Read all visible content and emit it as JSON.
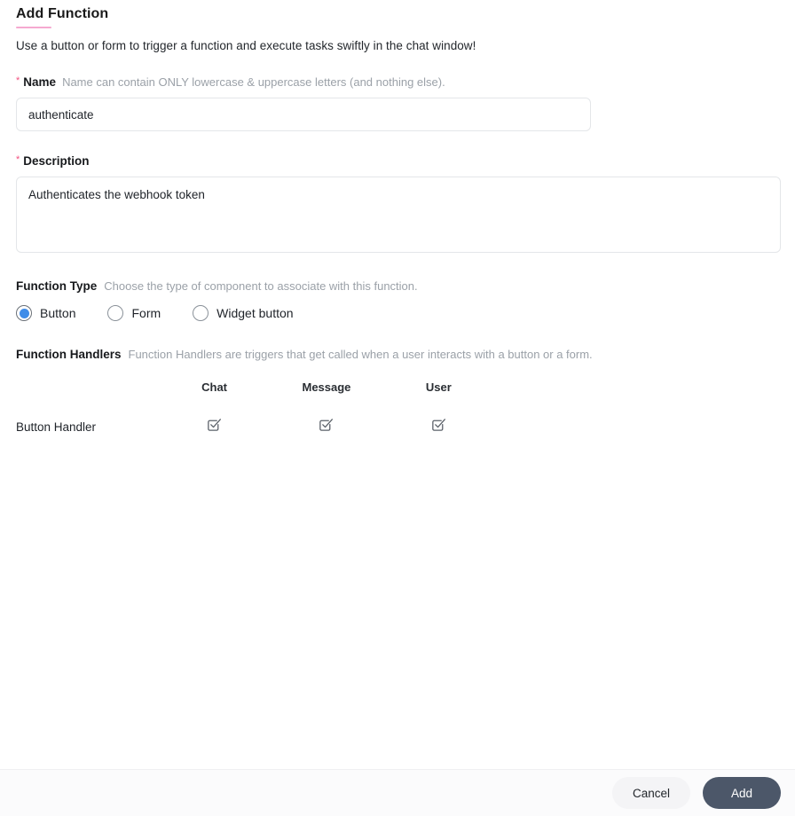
{
  "header": {
    "title": "Add Function",
    "subtitle": "Use a button or form to trigger a function and execute tasks swiftly in the chat window!",
    "accent_color": "#f5a9d0"
  },
  "name_field": {
    "required_marker": "*",
    "label": "Name",
    "hint": "Name can contain ONLY lowercase & uppercase letters (and nothing else).",
    "value": "authenticate",
    "placeholder": ""
  },
  "description_field": {
    "required_marker": "*",
    "label": "Description",
    "value": "Authenticates the webhook token",
    "placeholder": ""
  },
  "function_type": {
    "label": "Function Type",
    "hint": "Choose the type of component to associate with this function.",
    "selected": "Button",
    "selected_color": "#3f8ce8",
    "options": [
      {
        "label": "Button",
        "checked": true
      },
      {
        "label": "Form",
        "checked": false
      },
      {
        "label": "Widget button",
        "checked": false
      }
    ]
  },
  "function_handlers": {
    "label": "Function Handlers",
    "hint": "Function Handlers are triggers that get called when a user interacts with a button or a form.",
    "columns": [
      "Chat",
      "Message",
      "User"
    ],
    "rows": [
      {
        "label": "Button Handler",
        "checked": [
          true,
          true,
          true
        ]
      }
    ]
  },
  "footer": {
    "cancel_label": "Cancel",
    "add_label": "Add",
    "add_color": "#4c5769"
  }
}
